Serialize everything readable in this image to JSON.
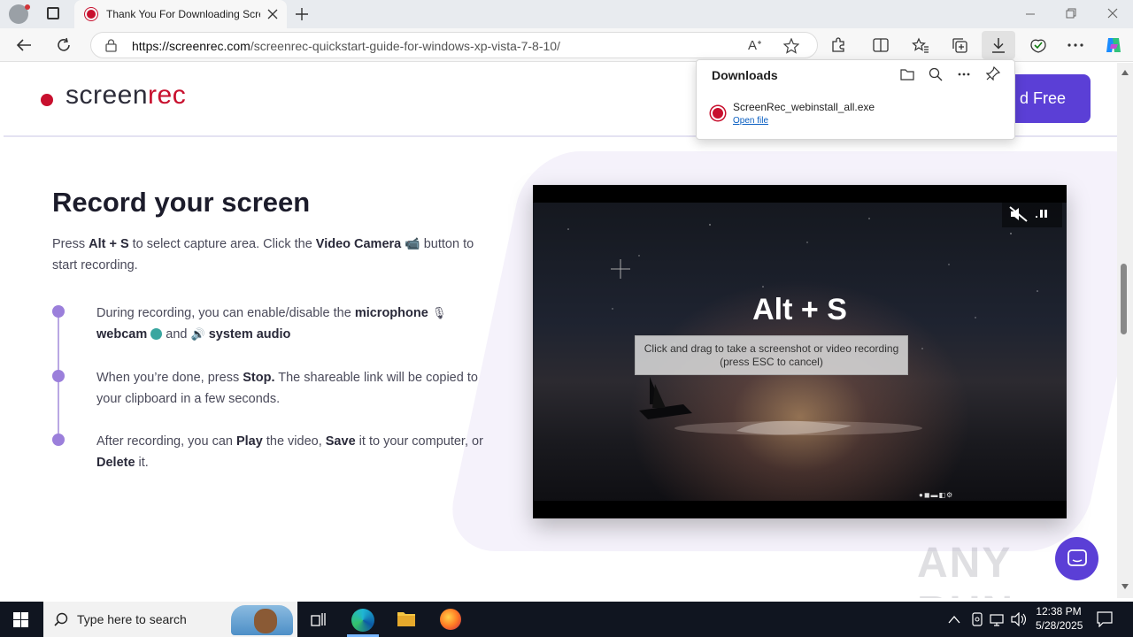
{
  "browser": {
    "tab_title": "Thank You For Downloading ScreenRec",
    "url_domain": "https://screenrec.com",
    "url_path": "/screenrec-quickstart-guide-for-windows-xp-vista-7-8-10/"
  },
  "site": {
    "logo_prefix": "screen",
    "logo_suffix": "rec",
    "download_button": "d Free"
  },
  "content": {
    "heading": "Record your screen",
    "intro_pre": "Press ",
    "intro_key": "Alt + S",
    "intro_mid": " to select capture area. Click the ",
    "intro_cam": "Video Camera",
    "intro_post": " button to start recording.",
    "b1_pre": "During recording, you can enable/disable the ",
    "b1_mic": "microphone",
    "b1_cam": "webcam",
    "b1_and": " and ",
    "b1_audio": "system audio",
    "b2_pre": "When you’re done, press ",
    "b2_stop": "Stop.",
    "b2_post": " The shareable link will be copied to your clipboard in a few seconds.",
    "b3_pre": "After recording, you can ",
    "b3_play": "Play",
    "b3_mid": " the video, ",
    "b3_save": "Save",
    "b3_mid2": " it to your computer, or ",
    "b3_delete": "Delete",
    "b3_post": " it."
  },
  "video": {
    "big_text": "Alt + S",
    "tooltip_line1": "Click and drag to take a screenshot or video recording",
    "tooltip_line2": "(press ESC to cancel)"
  },
  "downloads": {
    "title": "Downloads",
    "file_name": "ScreenRec_webinstall_all.exe",
    "open_link": "Open file"
  },
  "watermark": "ANY RUN",
  "taskbar": {
    "search_placeholder": "Type here to search",
    "time": "12:38 PM",
    "date": "5/28/2025"
  }
}
